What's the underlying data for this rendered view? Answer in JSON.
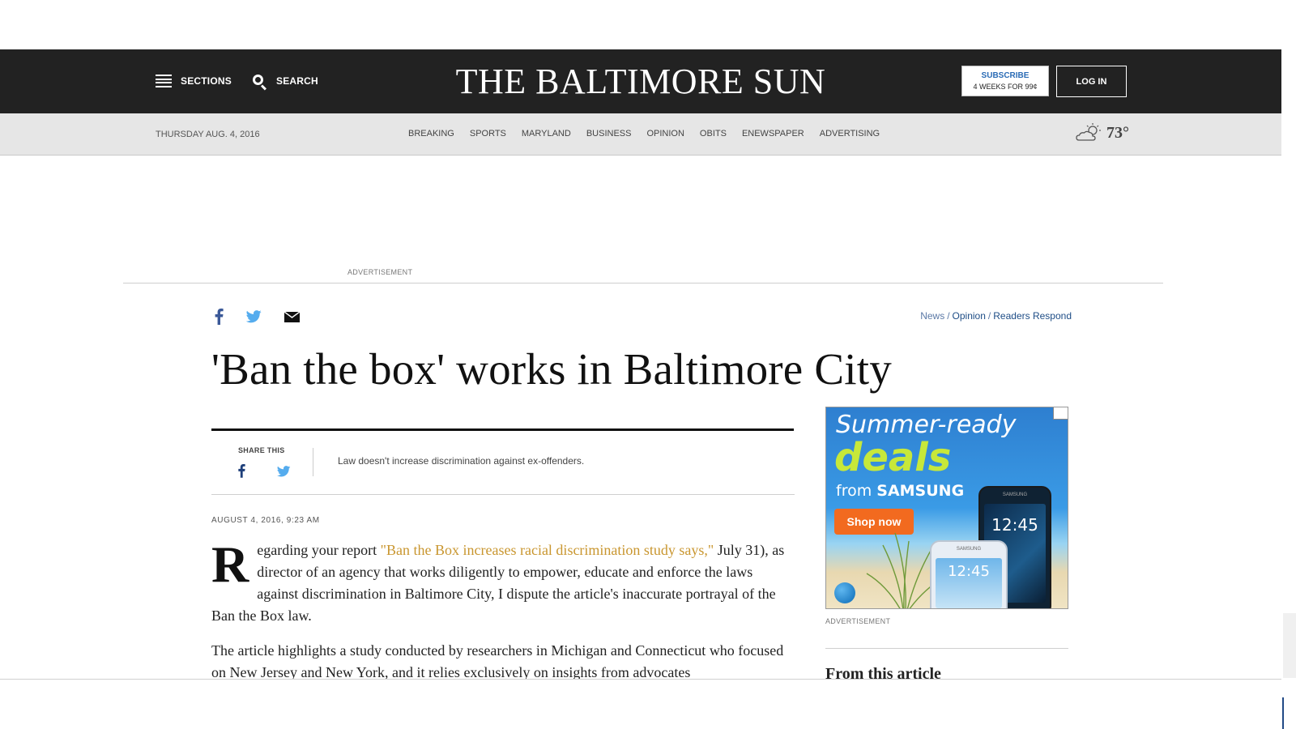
{
  "header": {
    "sections_label": "SECTIONS",
    "search_label": "SEARCH",
    "logo": "THE BALTIMORE SUN",
    "subscribe_line1": "SUBSCRIBE",
    "subscribe_line2": "4 WEEKS FOR 99¢",
    "login_label": "LOG IN"
  },
  "navbar": {
    "date": "THURSDAY AUG. 4, 2016",
    "links": [
      "BREAKING",
      "SPORTS",
      "MARYLAND",
      "BUSINESS",
      "OPINION",
      "OBITS",
      "ENEWSPAPER",
      "ADVERTISING"
    ],
    "temperature": "73°",
    "weather_icon": "partly-cloudy-icon"
  },
  "top_ad": {
    "label": "ADVERTISEMENT"
  },
  "breadcrumb": [
    "News",
    "Opinion",
    "Readers Respond"
  ],
  "breadcrumb_sep": "/",
  "article": {
    "title": "'Ban the box' works in Baltimore City",
    "share_label": "SHARE THIS",
    "dek": "Law doesn't increase discrimination against ex-offenders.",
    "timestamp": "AUGUST 4, 2016, 9:23 AM",
    "dropcap": "R",
    "p1_start": "egarding your report ",
    "p1_link": "\"Ban the Box increases racial discrimination study says,\"",
    "p1_end": " July 31), as director of an agency that works diligently to empower, educate and enforce the laws against discrimination in Baltimore City, I dispute the article's inaccurate portrayal of the Ban the Box law.",
    "p2": "The article highlights a study conducted by researchers in Michigan and Connecticut who focused on New Jersey and New York, and it relies exclusively on insights from advocates"
  },
  "side_ad": {
    "line1": "Summer-ready",
    "line2": "deals",
    "line3_pre": "from ",
    "line3_brand": "SAMSUNG",
    "button": "Shop now",
    "phone_time": "12:45",
    "phone_brand": "SAMSUNG",
    "label": "ADVERTISEMENT"
  },
  "sidebar": {
    "from_article": "From this article"
  },
  "colors": {
    "header_bg": "#222222",
    "navbar_bg": "#e6e6e6",
    "link_gold": "#c9962f",
    "breadcrumb_blue": "#1e4d86",
    "facebook": "#3b5998",
    "twitter": "#55acee"
  }
}
